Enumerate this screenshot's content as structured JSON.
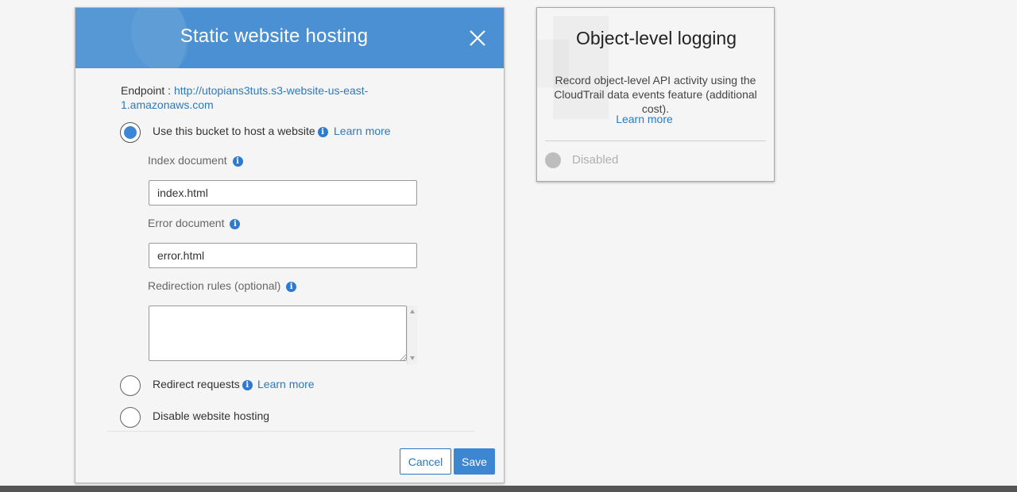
{
  "hosting_dialog": {
    "title": "Static website hosting",
    "endpoint_label": "Endpoint : ",
    "endpoint_url": "http://utopians3tuts.s3-website-us-east-1.amazonaws.com",
    "options": {
      "host": {
        "label": "Use this bucket to host a website",
        "learn_more": "Learn more",
        "selected": true
      },
      "redirect": {
        "label": "Redirect requests",
        "learn_more": "Learn more",
        "selected": false
      },
      "disable": {
        "label": "Disable website hosting",
        "selected": false
      }
    },
    "index_document": {
      "label": "Index document",
      "value": "index.html"
    },
    "error_document": {
      "label": "Error document",
      "value": "error.html"
    },
    "redirection_rules": {
      "label": "Redirection rules (optional)",
      "value": ""
    },
    "buttons": {
      "cancel": "Cancel",
      "save": "Save"
    },
    "accent_color": "#4a90d2"
  },
  "logging_card": {
    "title": "Object-level logging",
    "description": "Record object-level API activity using the CloudTrail data events feature (additional cost).",
    "learn_more": "Learn more",
    "status": "Disabled"
  },
  "icons": [
    "close-icon",
    "info-icon"
  ]
}
